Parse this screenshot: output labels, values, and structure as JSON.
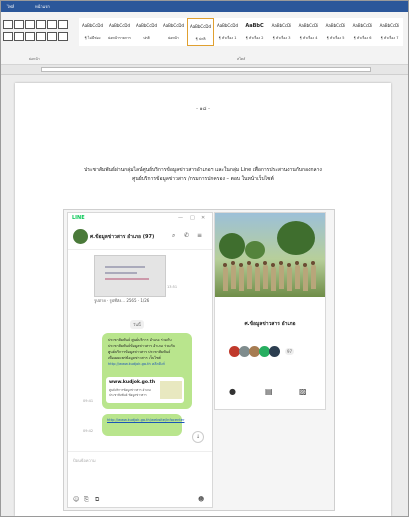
{
  "ribbon": {
    "tabs": [
      "ไฟล์",
      "หน้าแรก"
    ],
    "styles": [
      {
        "sample": "AaBbCcDd",
        "name": "¶ ไม่มีช่อง"
      },
      {
        "sample": "AaBbCcDd",
        "name": "ย่อหน้ารายการ"
      },
      {
        "sample": "AaBbCcDd",
        "name": "ปกติ"
      },
      {
        "sample": "AaBbCcDd",
        "name": "ย่อหน้า"
      },
      {
        "sample": "AaBbCcDd",
        "name": "¶ ปกติ"
      },
      {
        "sample": "AaBbCcDd",
        "name": "¶ หัวเรื่อง 1"
      },
      {
        "sample": "AaBbC",
        "name": "¶ หัวเรื่อง 2"
      },
      {
        "sample": "AaBbCcDi",
        "name": "¶ หัวเรื่อง 3"
      },
      {
        "sample": "AaBbCcDi",
        "name": "¶ หัวเรื่อง 4"
      },
      {
        "sample": "AaBbCcDi",
        "name": "¶ หัวเรื่อง 5"
      },
      {
        "sample": "AaBbCcDi",
        "name": "¶ หัวเรื่อง 6"
      },
      {
        "sample": "AaBbCcDi",
        "name": "¶ หัวเรื่อง 7"
      }
    ],
    "group_labels": [
      "ย่อหน้า",
      "สไตล์"
    ]
  },
  "document": {
    "page_number": "- ๑๘ -",
    "caption_line1": "ประชาสัมพันธ์ผ่านกลุ่มไลน์ศูนย์บริการข้อมูลข่าวสารอำเภอฯ และในกลุ่ม Line เพื่อการประสานงานกับกองกลาง",
    "caption_line2": "ศูนย์บริการข้อมูลข่าวสาร /กรมการปกครอง – ตอบ ในหน้าเว็บไซต์"
  },
  "chat": {
    "window_title": "LINE",
    "controls": [
      "—",
      "□",
      "✕"
    ],
    "group_name": "ศ.ข้อมูลข่าวสาร อำเภอ (97)",
    "photo_time": "13:51",
    "photo_sender": "รูปถ่าย · รูปที่ส่ง... 2565 · 1/26",
    "date_chip": "วันนี้",
    "bubble1_lines": [
      "ประชาสัมพันธ์ ศูนย์บริการ อำเภอ ร่วมกับ",
      "ประชาสัมพันธ์ข้อมูลข่าวสาร อำเภอ ร่วมกับ",
      "ศูนย์บริการข้อมูลข่าวสาร ประชาสัมพันธ์",
      "เพื่อเผยแพร่ข้อมูลข่าวสาร เว็บไซต์",
      "http://www.kudjok.go.th คลิกลิงก์"
    ],
    "link_title": "www.kudjok.go.th",
    "link_sub1": "ศูนย์บริการข้อมูลข่าวสาร อำเภอ",
    "link_sub2": "ประชาสัมพันธ์ ข้อมูลข่าวสาร",
    "bubble1_time": "09:41",
    "bubble2_text": "http://www.kudjok.go.th/website/infocenter",
    "bubble2_time": "09:42",
    "input_placeholder": "ป้อนข้อความ"
  },
  "profile": {
    "name": "ศ.ข้อมูลข่าวสาร อำเภอ",
    "member_count": "97",
    "member_colors": [
      "#c0392b",
      "#7f8c8d",
      "#a67c52",
      "#27ae60",
      "#2c3e50"
    ]
  }
}
